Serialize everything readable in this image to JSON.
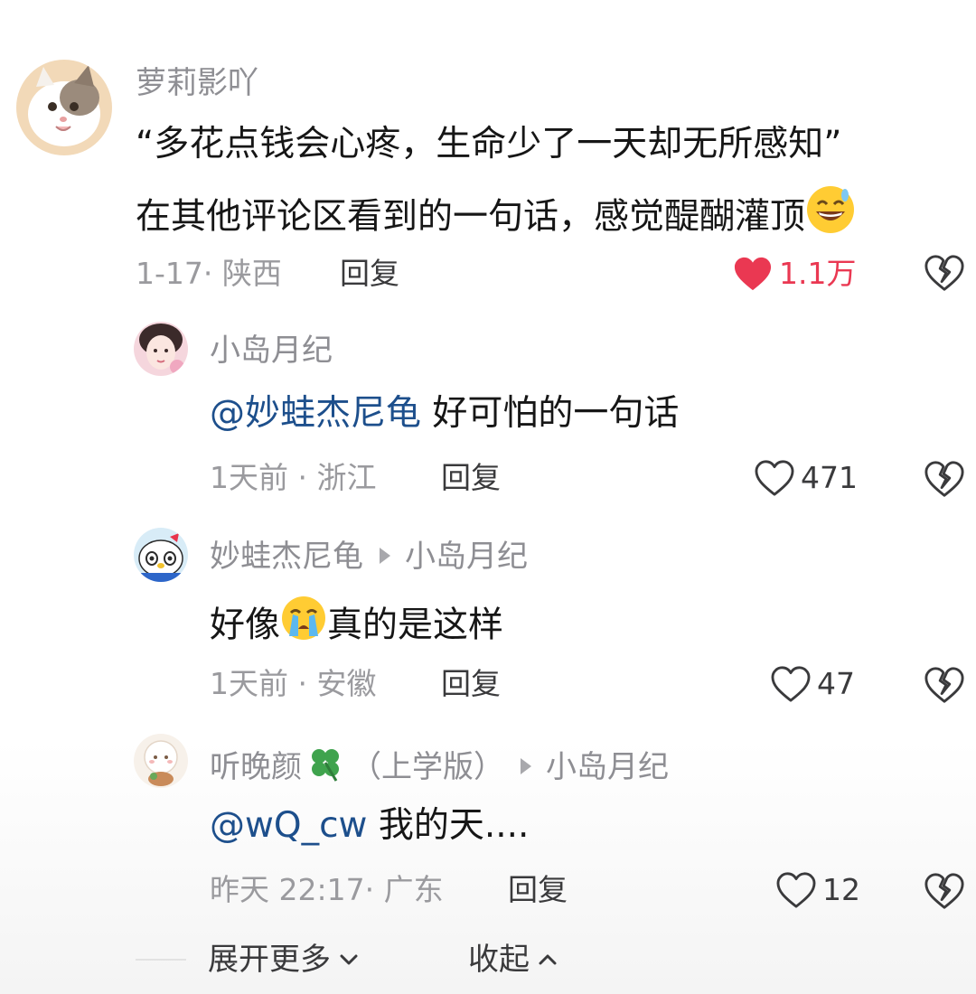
{
  "comments": [
    {
      "username": "萝莉影吖",
      "content_line1": "“多花点钱会心疼，生命少了一天却无所感知”",
      "content_line2": "在其他评论区看到的一句话，感觉醍醐灌顶",
      "emoji": "grinning-sweat-emoji",
      "meta": "1-17· 陕西",
      "reply_label": "回复",
      "likes": "1.1万",
      "liked": true
    },
    {
      "username": "小岛月纪",
      "mention": "@妙蛙杰尼龟",
      "content": " 好可怕的一句话",
      "meta": "1天前 · 浙江",
      "reply_label": "回复",
      "likes": "471"
    },
    {
      "username": "妙蛙杰尼龟",
      "reply_to": "小岛月纪",
      "content_before": "好像",
      "emoji": "crying-emoji",
      "content_after": "真的是这样",
      "meta": "1天前 · 安徽",
      "reply_label": "回复",
      "likes": "47"
    },
    {
      "username": "听晚颜",
      "username_emoji": "four-leaf-clover-emoji",
      "username_suffix": "（上学版）",
      "reply_to": "小岛月纪",
      "mention": "@wQ_cw",
      "content": " 我的天....",
      "meta": "昨天 22:17· 广东",
      "reply_label": "回复",
      "likes": "12"
    }
  ],
  "footer": {
    "expand_label": "展开更多",
    "collapse_label": "收起"
  },
  "colors": {
    "like_active": "#ea3852",
    "mention": "#1d4f8c",
    "meta_gray": "#9a9a9e"
  }
}
